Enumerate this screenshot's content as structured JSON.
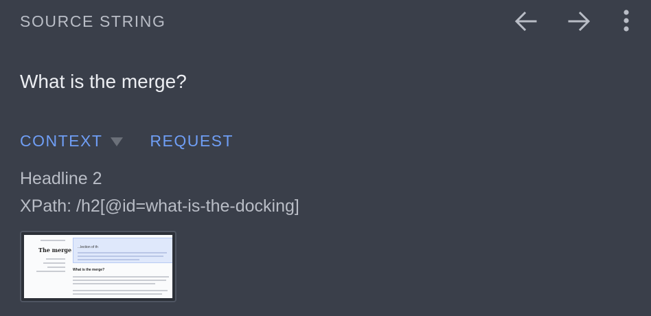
{
  "header": {
    "title": "SOURCE STRING",
    "back_icon": "arrow-left-icon",
    "forward_icon": "arrow-right-icon",
    "more_icon": "more-vertical-icon"
  },
  "source": {
    "text": "What is the merge?"
  },
  "tabs": [
    {
      "label": "CONTEXT"
    },
    {
      "label": "REQUEST"
    }
  ],
  "context": {
    "element_type": "Headline 2",
    "xpath": "XPath: /h2[@id=what-is-the-docking]"
  },
  "screenshot_thumb": {
    "page_title": "The merge",
    "panel_heading": "...lection of th",
    "body_heading": "What is the merge?"
  },
  "colors": {
    "background": "#3a3f4a",
    "accent": "#6f9ef5",
    "muted_text": "#b9bdc6",
    "primary_text": "#eceef2"
  }
}
